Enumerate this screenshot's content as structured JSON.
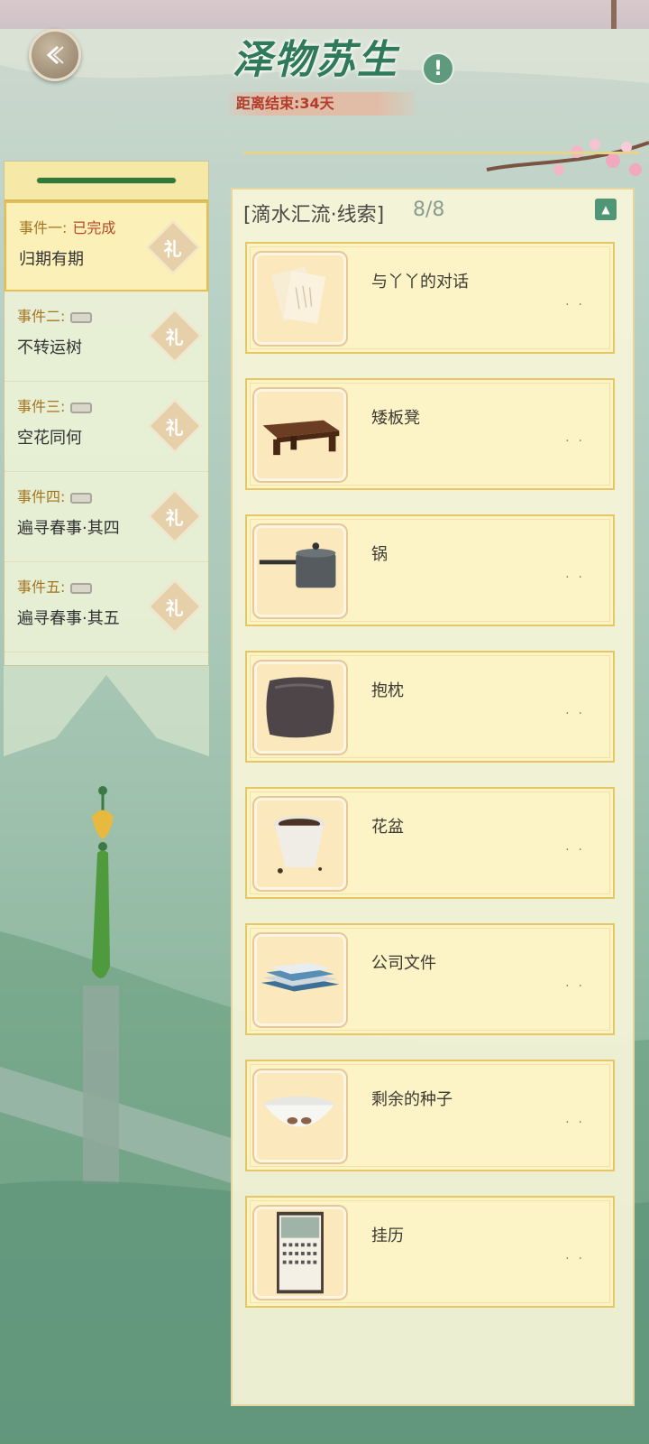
{
  "header": {
    "title": "泽物苏生",
    "countdown": "距离结束:34天",
    "info_symbol": "!"
  },
  "events": [
    {
      "label": "事件一:",
      "status": "已完成",
      "name": "归期有期",
      "active": true,
      "locked": false
    },
    {
      "label": "事件二:",
      "status": "",
      "name": "不转运树",
      "active": false,
      "locked": true
    },
    {
      "label": "事件三:",
      "status": "",
      "name": "空花同何",
      "active": false,
      "locked": true
    },
    {
      "label": "事件四:",
      "status": "",
      "name": "遍寻春事·其四",
      "active": false,
      "locked": true
    },
    {
      "label": "事件五:",
      "status": "",
      "name": "遍寻春事·其五",
      "active": false,
      "locked": true
    }
  ],
  "clues_panel": {
    "title": "[滴水汇流·线索]",
    "count": "8/8",
    "collapse_symbol": "▲"
  },
  "clues": [
    {
      "name": "与丫丫的对话",
      "icon": "letters-icon"
    },
    {
      "name": "矮板凳",
      "icon": "stool-icon"
    },
    {
      "name": "锅",
      "icon": "pot-icon"
    },
    {
      "name": "抱枕",
      "icon": "pillow-icon"
    },
    {
      "name": "花盆",
      "icon": "flowerpot-icon"
    },
    {
      "name": "公司文件",
      "icon": "documents-icon"
    },
    {
      "name": "剩余的种子",
      "icon": "seed-bowl-icon"
    },
    {
      "name": "挂历",
      "icon": "wall-calendar-icon"
    }
  ],
  "item_dots": "··",
  "gift_symbol": "礼",
  "colors": {
    "accent_green": "#2f7a5a",
    "completed_red": "#b8452e",
    "event_label": "#a4741f",
    "card_border": "#e7c765"
  }
}
